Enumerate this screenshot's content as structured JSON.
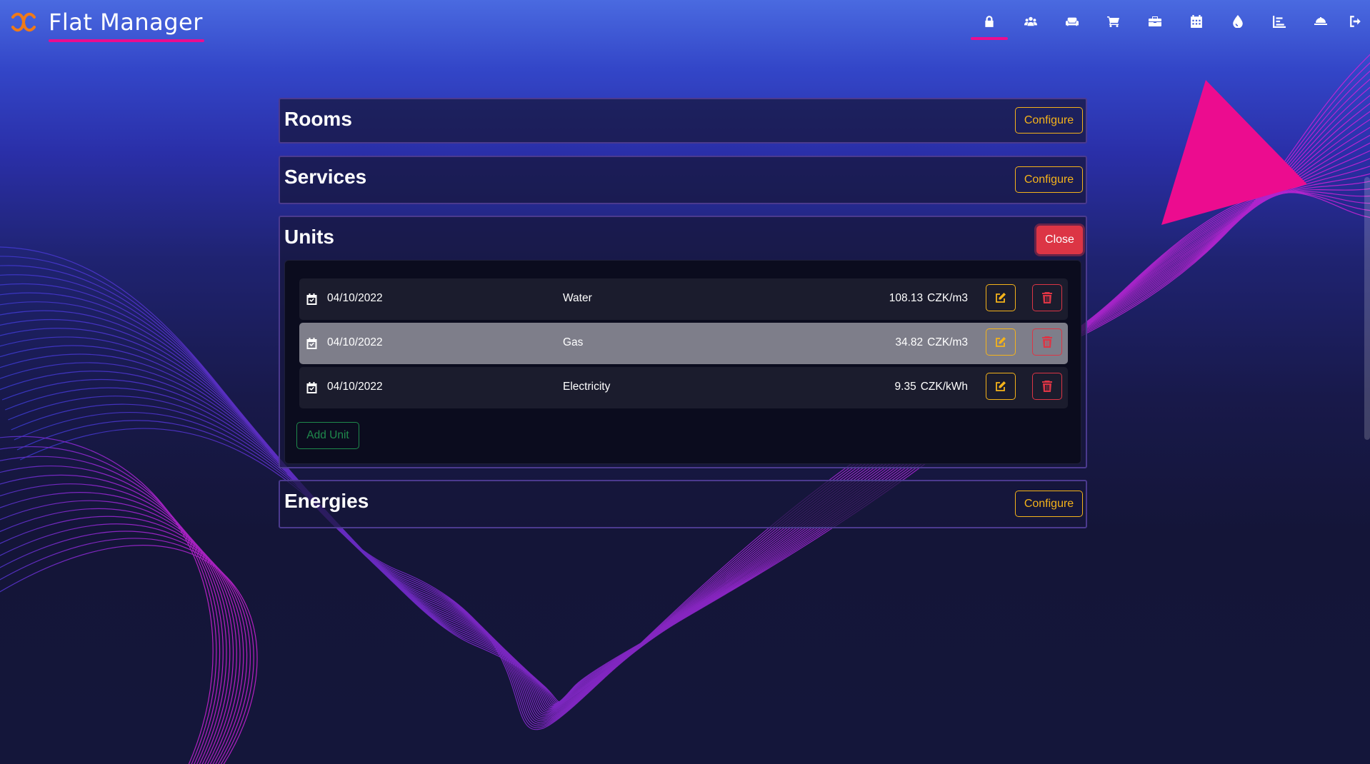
{
  "app": {
    "title": "Flat Manager"
  },
  "colors": {
    "accent": "#ec0c8f",
    "warning": "#f5b31a",
    "danger": "#dc3545",
    "success": "#1f8a4c"
  },
  "nav": {
    "items": [
      {
        "name": "lock-icon",
        "active": true
      },
      {
        "name": "users-icon",
        "active": false
      },
      {
        "name": "sofa-icon",
        "active": false
      },
      {
        "name": "cart-icon",
        "active": false
      },
      {
        "name": "briefcase-icon",
        "active": false
      },
      {
        "name": "calendar-icon",
        "active": false
      },
      {
        "name": "drop-icon",
        "active": false
      },
      {
        "name": "chart-icon",
        "active": false
      },
      {
        "name": "service-bell-icon",
        "active": false
      },
      {
        "name": "logout-icon",
        "active": false
      }
    ]
  },
  "sections": {
    "rooms": {
      "title": "Rooms",
      "button": "Configure"
    },
    "services": {
      "title": "Services",
      "button": "Configure"
    },
    "units": {
      "title": "Units",
      "button": "Close",
      "add_button": "Add Unit",
      "rows": [
        {
          "date": "04/10/2022",
          "name": "Water",
          "price": "108.13",
          "unit": "CZK/m3",
          "hover": false
        },
        {
          "date": "04/10/2022",
          "name": "Gas",
          "price": "34.82",
          "unit": "CZK/m3",
          "hover": true
        },
        {
          "date": "04/10/2022",
          "name": "Electricity",
          "price": "9.35",
          "unit": "CZK/kWh",
          "hover": false
        }
      ]
    },
    "energies": {
      "title": "Energies",
      "button": "Configure"
    }
  }
}
